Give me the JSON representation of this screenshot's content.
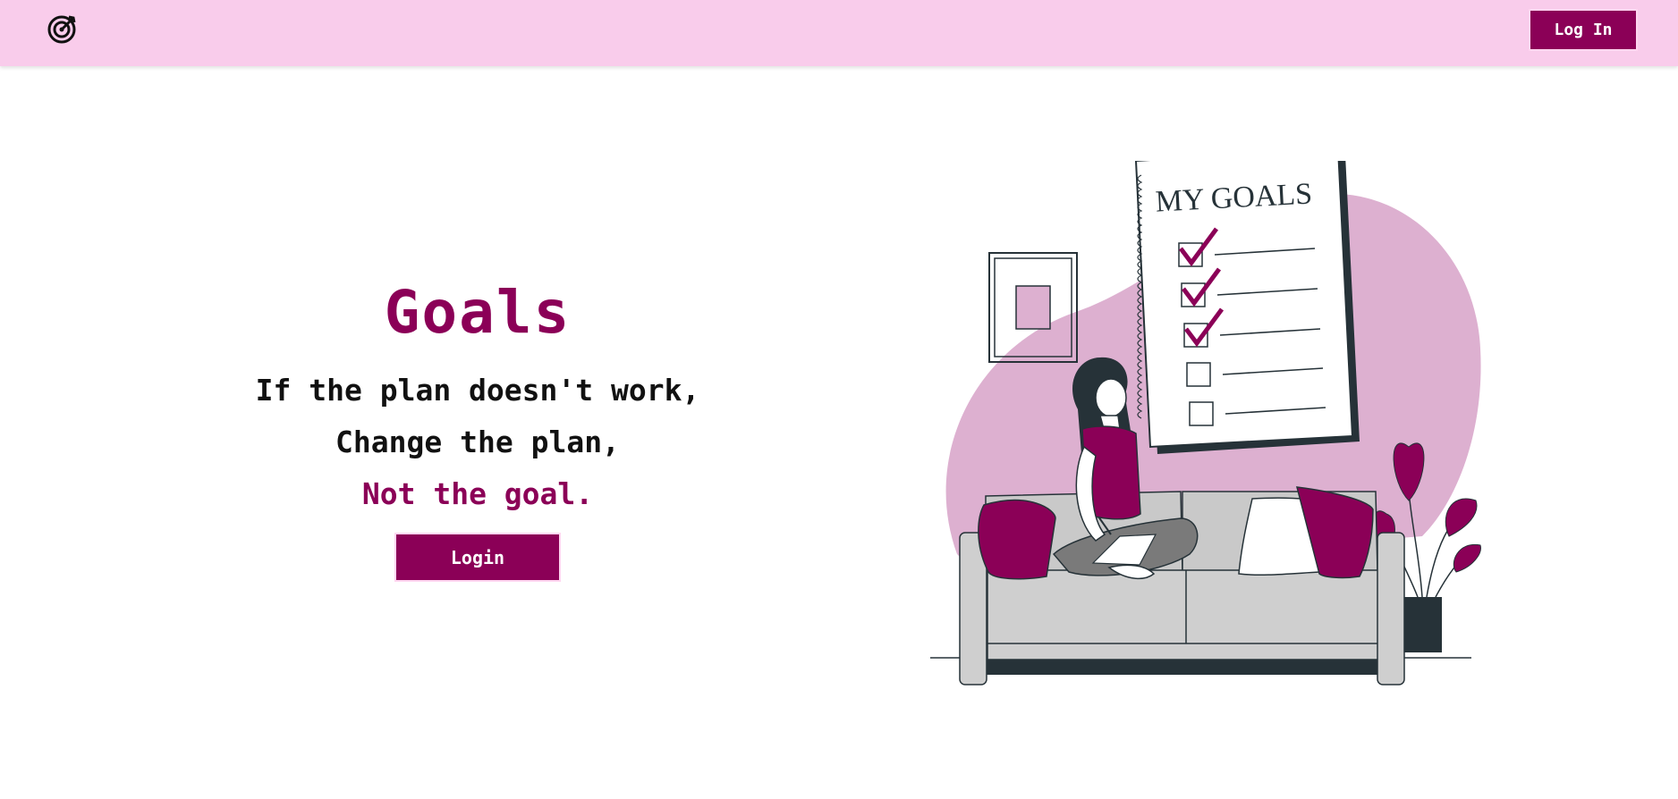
{
  "navbar": {
    "logo_icon": "target-icon",
    "login_label": "Log In"
  },
  "hero": {
    "title": "Goals",
    "quote_lines": [
      "If the plan doesn't work,",
      "Change the plan,",
      "Not the goal."
    ],
    "login_label": "Login"
  },
  "illustration": {
    "poster_title": "MY GOALS",
    "icons": [
      "checkbox-checked-icon",
      "checkbox-empty-icon",
      "plant-icon",
      "sofa-icon",
      "picture-frame-icon"
    ]
  },
  "colors": {
    "accent": "#8b0057",
    "nav_bg": "#f9cceb",
    "blob": "#ddb0d0",
    "dark": "#263238",
    "sofa": "#c9c9c9"
  }
}
